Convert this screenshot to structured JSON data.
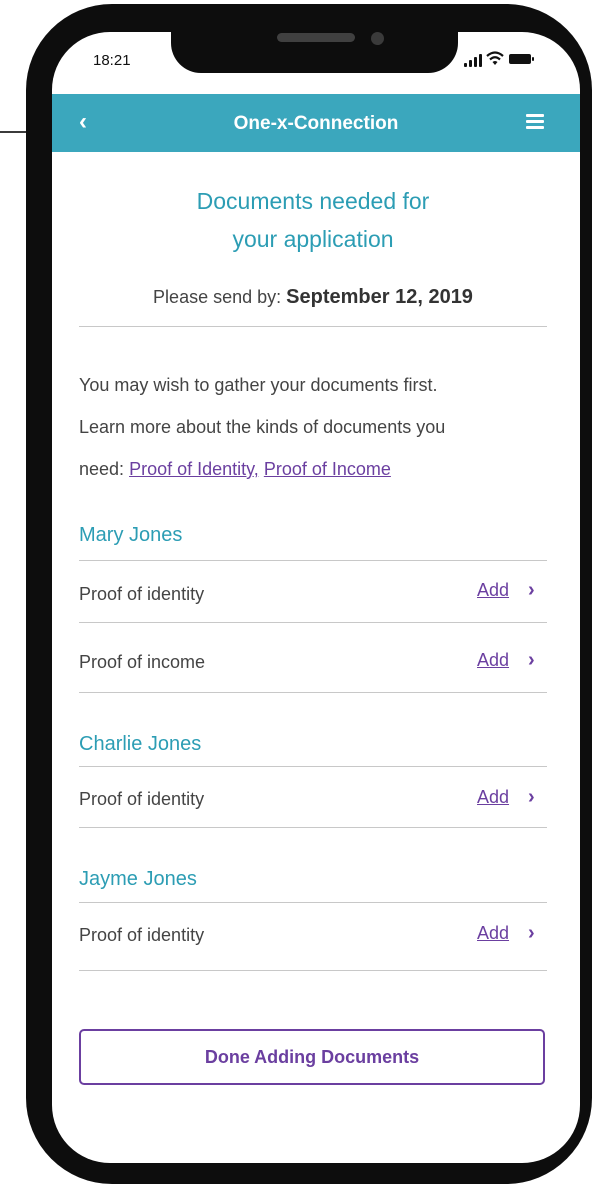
{
  "status_bar": {
    "time": "18:21"
  },
  "nav": {
    "back_icon": "chevron-left-icon",
    "back_glyph": "‹",
    "title": "One-x-Connection",
    "menu_icon": "hamburger-menu-icon"
  },
  "header": {
    "title_line1": "Documents needed for",
    "title_line2": "your application",
    "send_by_label": "Please send by:",
    "send_by_date": "September 12, 2019"
  },
  "intro": {
    "line1": "You may wish to gather your documents first.",
    "line2": "Learn more about the kinds of documents you",
    "line3_prefix": "need:",
    "link_identity": "Proof of Identity",
    "separator": ",",
    "link_income": "Proof of Income"
  },
  "people": [
    {
      "name": "Mary Jones",
      "docs": [
        {
          "label": "Proof of identity",
          "action": "Add",
          "chevron": "›"
        },
        {
          "label": "Proof of income",
          "action": "Add",
          "chevron": "›"
        }
      ]
    },
    {
      "name": "Charlie Jones",
      "docs": [
        {
          "label": "Proof of identity",
          "action": "Add",
          "chevron": "›"
        }
      ]
    },
    {
      "name": "Jayme Jones",
      "docs": [
        {
          "label": "Proof of identity",
          "action": "Add",
          "chevron": "›"
        }
      ]
    }
  ],
  "footer": {
    "done_label": "Done Adding Documents"
  },
  "colors": {
    "accent": "#3ba7bd",
    "heading": "#2c9db4",
    "link": "#6b3fa0",
    "text": "#444444"
  }
}
